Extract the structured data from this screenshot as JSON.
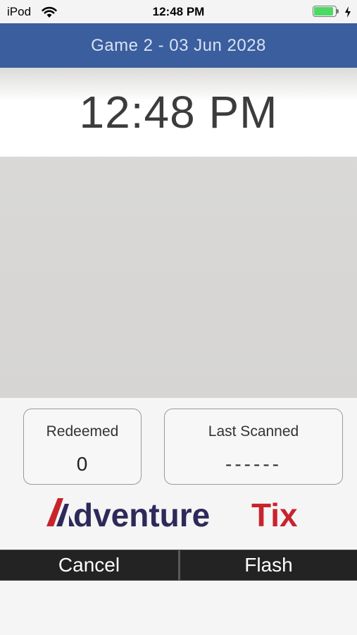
{
  "status_bar": {
    "carrier": "iPod",
    "time": "12:48 PM",
    "battery_level": 0.9,
    "battery_color": "#4cd964",
    "icons": [
      "wifi-icon",
      "battery-icon",
      "charging-bolt-icon"
    ]
  },
  "header": {
    "title": "Game 2 - 03 Jun 2028",
    "background": "#3a5e9e"
  },
  "clock": {
    "time": "12:48 PM"
  },
  "stats": {
    "redeemed": {
      "label": "Redeemed",
      "value": "0"
    },
    "last_scanned": {
      "label": "Last Scanned",
      "value": "------"
    }
  },
  "logo": {
    "text": "AdventureTix",
    "colors": {
      "primary": "#2d2a5a",
      "accent": "#c8242e"
    }
  },
  "bottom_bar": {
    "cancel_label": "Cancel",
    "flash_label": "Flash"
  }
}
